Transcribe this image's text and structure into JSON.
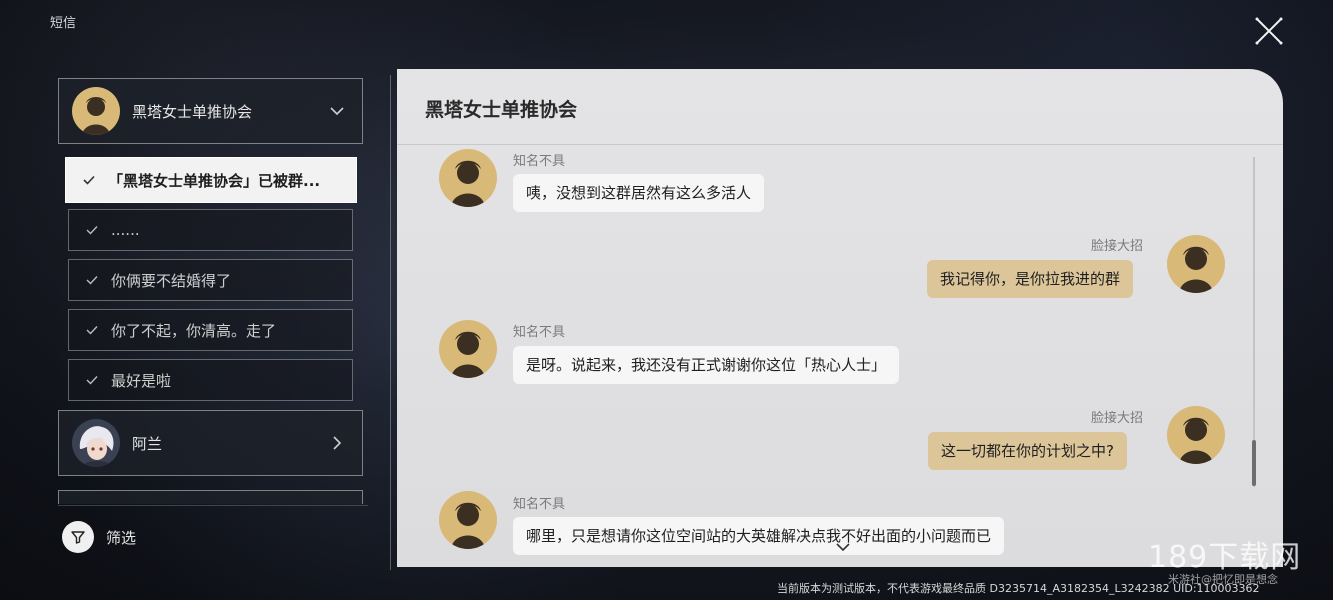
{
  "app_title": "短信",
  "contacts": [
    {
      "name": "黑塔女士单推协会",
      "expanded": true
    },
    {
      "name": "阿兰",
      "expanded": false
    }
  ],
  "threads": [
    {
      "label": "「黑塔女士单推协会」已被群...",
      "active": true
    },
    {
      "label": "......",
      "active": false
    },
    {
      "label": "你俩要不结婚得了",
      "active": false
    },
    {
      "label": "你了不起，你清高。走了",
      "active": false
    },
    {
      "label": "最好是啦",
      "active": false
    }
  ],
  "filter_label": "筛选",
  "chat": {
    "title": "黑塔女士单推协会",
    "messages": [
      {
        "sender": "知名不具",
        "text": "咦，没想到这群居然有这么多活人",
        "side": "in"
      },
      {
        "sender": "脸接大招",
        "text": "我记得你，是你拉我进的群",
        "side": "out"
      },
      {
        "sender": "知名不具",
        "text": "是呀。说起来，我还没有正式谢谢你这位「热心人士」",
        "side": "in"
      },
      {
        "sender": "脸接大招",
        "text": "这一切都在你的计划之中?",
        "side": "out"
      },
      {
        "sender": "知名不具",
        "text": "哪里，只是想请你这位空间站的大英雄解决点我不好出面的小问题而已",
        "side": "in"
      }
    ]
  },
  "footer_note": "当前版本为测试版本，不代表游戏最终品质 D3235714_A3182354_L3242382 UID:110003362",
  "watermark": {
    "logo": "189下载网",
    "sub": "米游社@把忆即是想念"
  },
  "colors": {
    "outgoing_bubble": "#dcc699",
    "incoming_bubble": "#f6f6f6",
    "panel": "#e2e2e4"
  },
  "icons": {
    "close": "close-icon",
    "chevron_down": "chevron-down-icon",
    "chevron_right": "chevron-right-icon",
    "check": "check-icon",
    "filter": "filter-icon"
  }
}
